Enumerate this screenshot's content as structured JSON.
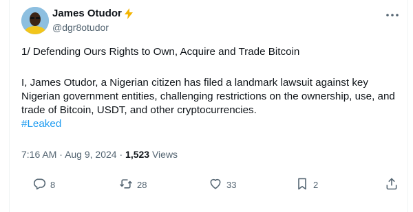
{
  "author": {
    "name": "James Otudor",
    "handle": "@dgr8otudor"
  },
  "post": {
    "line1": "1/ Defending Ours Rights to Own, Acquire and Trade  Bitcoin",
    "body": "I, James Otudor, a Nigerian citizen has filed a landmark lawsuit against key Nigerian government entities, challenging restrictions on the ownership, use, and trade of Bitcoin, USDT, and other cryptocurrencies.",
    "hashtag": "#Leaked"
  },
  "meta": {
    "time": "7:16 AM",
    "sep": "·",
    "date": "Aug 9, 2024",
    "views_count": "1,523",
    "views_label": "Views"
  },
  "actions": {
    "replies": "8",
    "reposts": "28",
    "likes": "33",
    "bookmarks": "2"
  },
  "colors": {
    "accent": "#1d9bf0",
    "muted": "#536471",
    "text": "#0f1419",
    "bolt": "#f4b400"
  },
  "icons": [
    "lightning-icon",
    "more-icon",
    "reply-icon",
    "repost-icon",
    "like-icon",
    "bookmark-icon",
    "share-icon"
  ]
}
